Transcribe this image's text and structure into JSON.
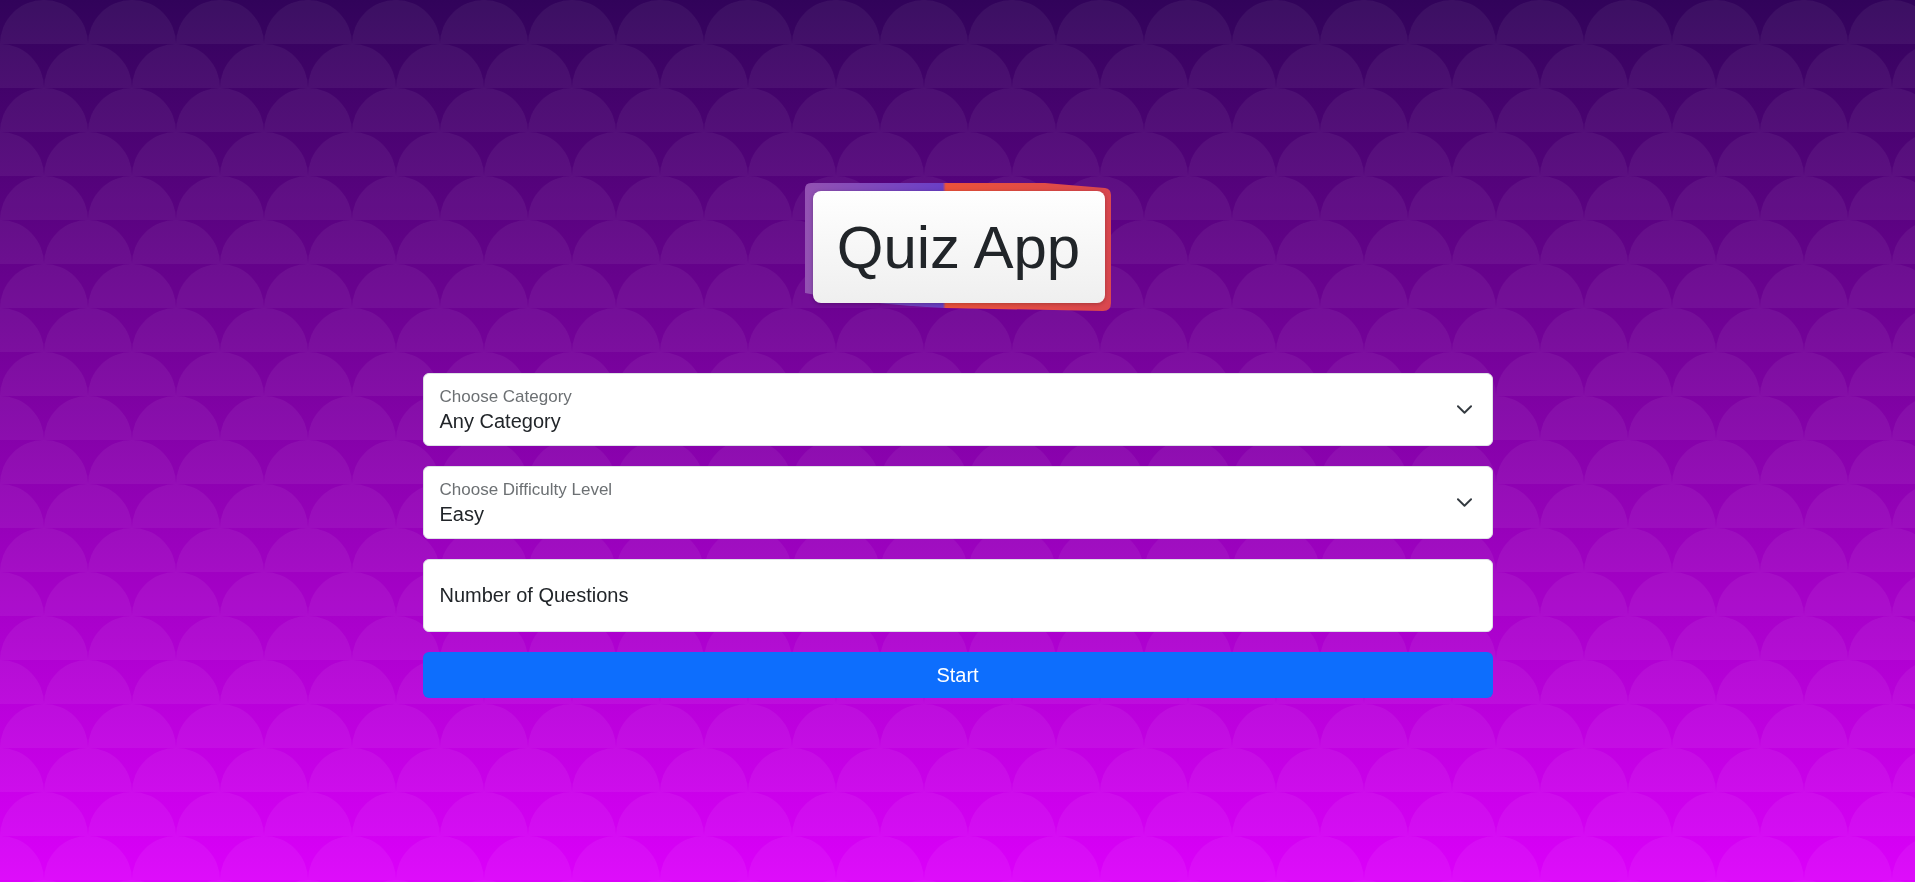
{
  "title": "Quiz App",
  "fields": [
    {
      "kind": "select",
      "label": "Choose Category",
      "value": "Any Category"
    },
    {
      "kind": "select",
      "label": "Choose Difficulty Level",
      "value": "Easy"
    },
    {
      "kind": "number",
      "placeholder": "Number of Questions"
    }
  ],
  "start_button": {
    "label": "Start"
  }
}
